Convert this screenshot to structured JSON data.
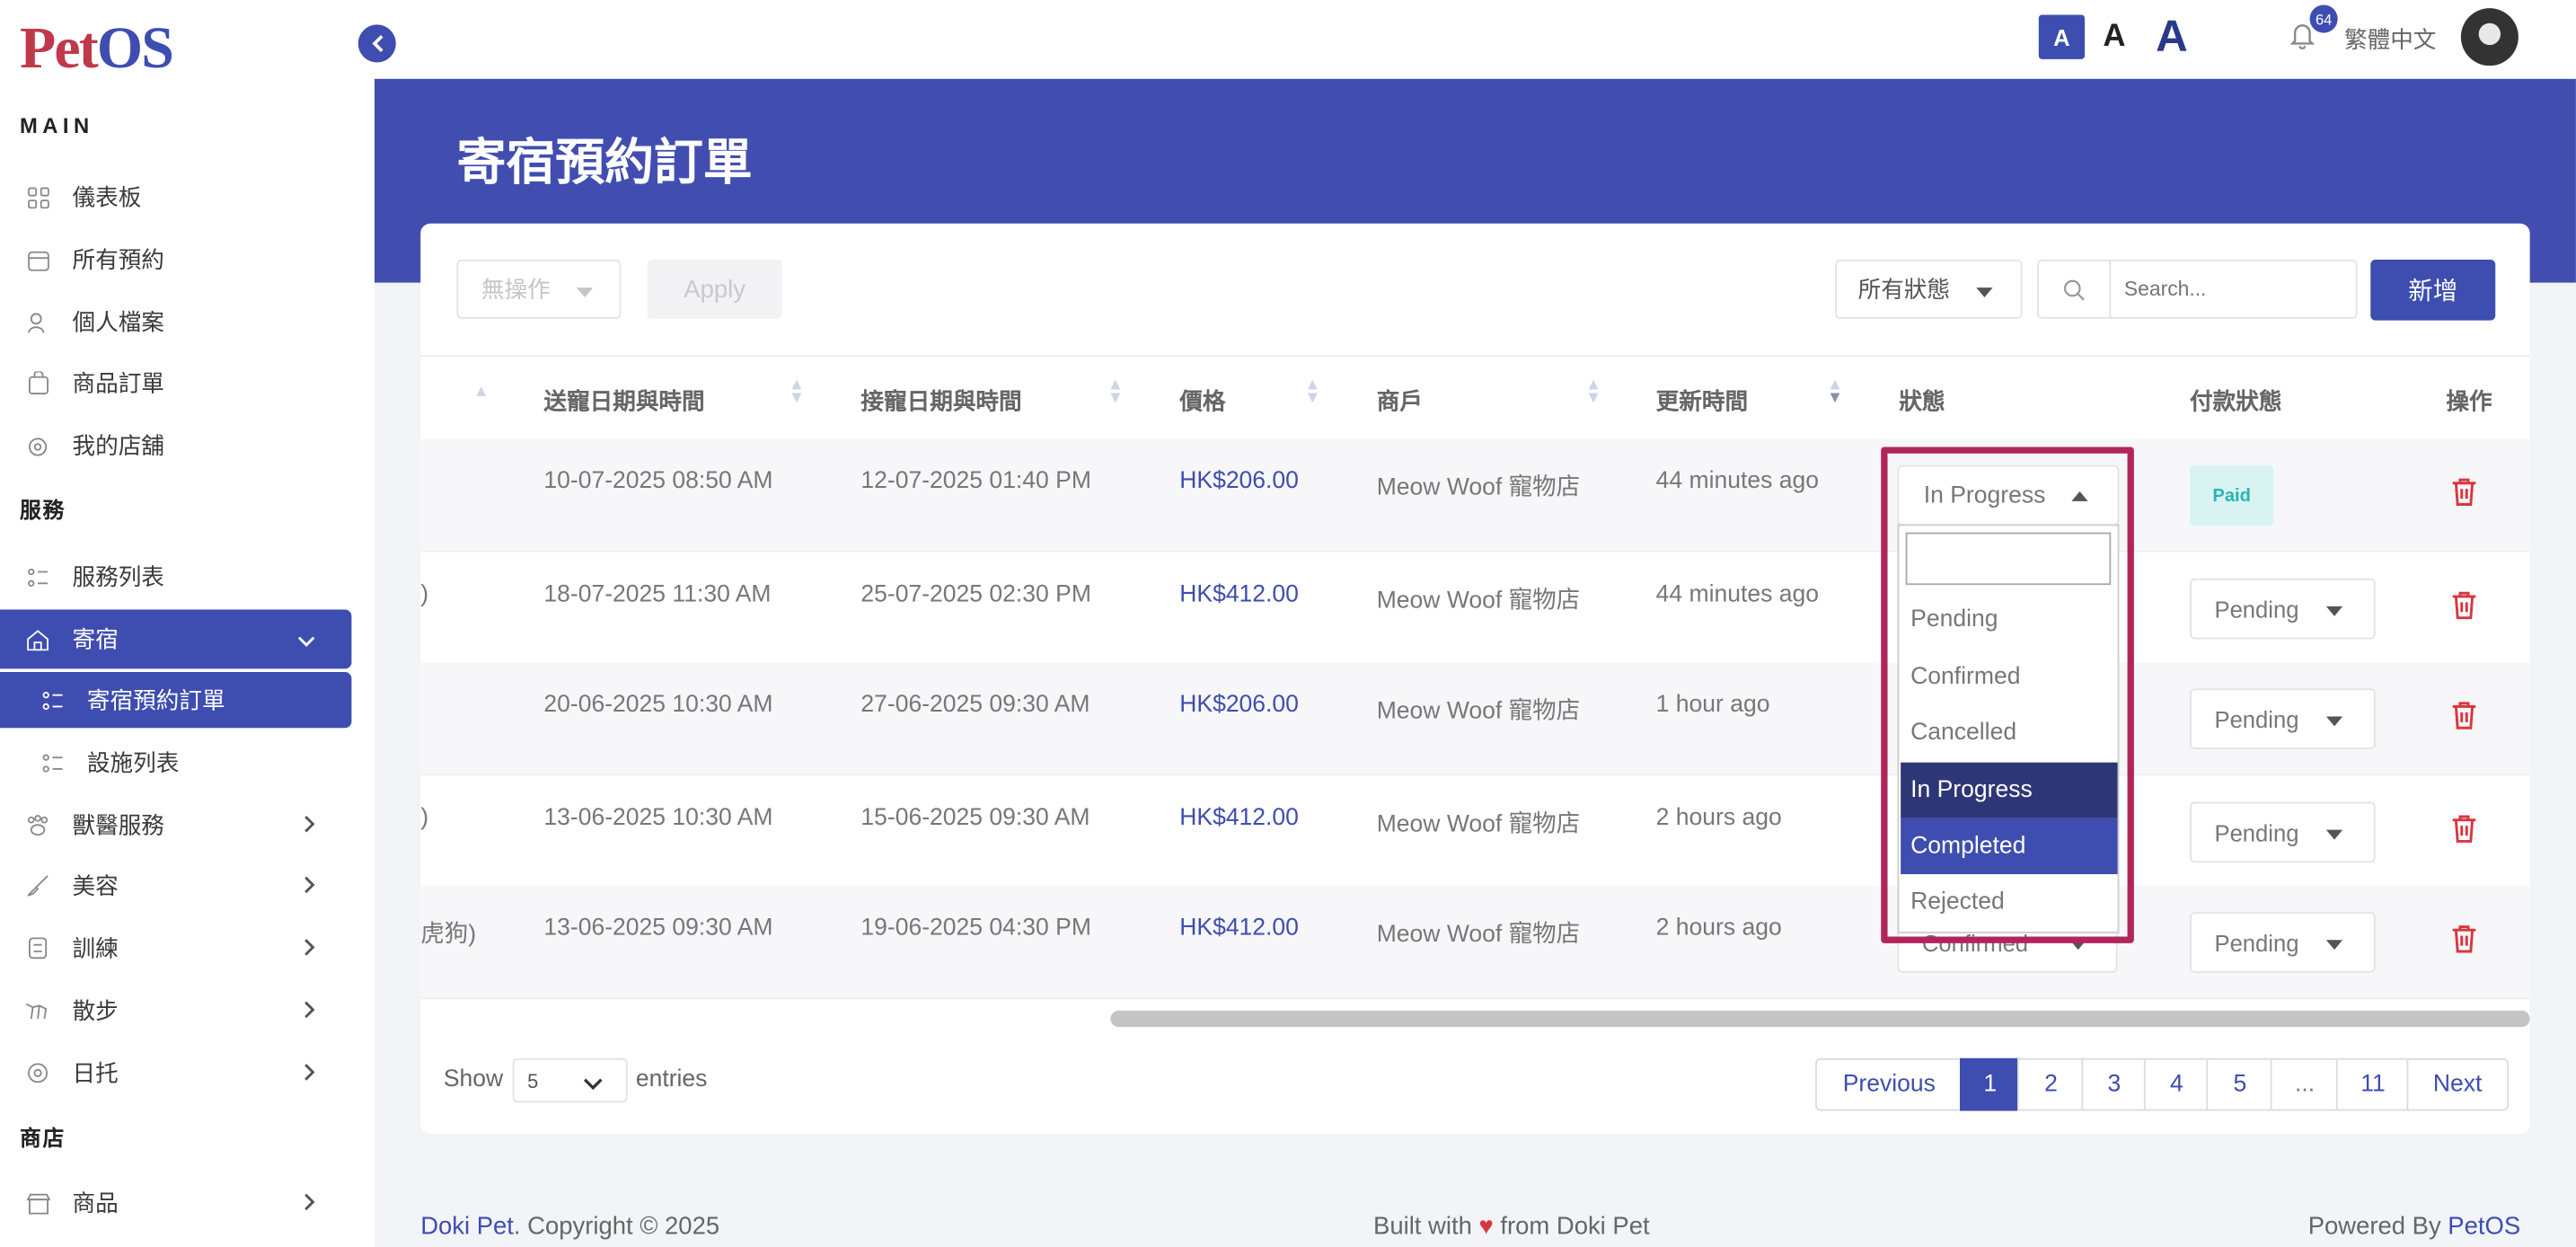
{
  "brand": {
    "logo_part1": "Pet",
    "logo_part2": "OS"
  },
  "sidebar": {
    "section_main": "MAIN",
    "section_services": "服務",
    "section_shop": "商店",
    "items": [
      {
        "label": "儀表板",
        "icon": "grid-icon"
      },
      {
        "label": "所有預約",
        "icon": "calendar-icon"
      },
      {
        "label": "個人檔案",
        "icon": "user-icon"
      },
      {
        "label": "商品訂單",
        "icon": "bag-icon"
      },
      {
        "label": "我的店舖",
        "icon": "store-icon"
      },
      {
        "label": "服務列表",
        "icon": "list-icon"
      },
      {
        "label": "寄宿",
        "icon": "home-icon"
      },
      {
        "label": "寄宿預約訂單",
        "icon": "list-icon"
      },
      {
        "label": "設施列表",
        "icon": "list-icon"
      },
      {
        "label": "獸醫服務",
        "icon": "vet-icon"
      },
      {
        "label": "美容",
        "icon": "brush-icon"
      },
      {
        "label": "訓練",
        "icon": "training-icon"
      },
      {
        "label": "散步",
        "icon": "walk-icon"
      },
      {
        "label": "日托",
        "icon": "daycare-icon"
      },
      {
        "label": "商品",
        "icon": "shop-icon"
      }
    ]
  },
  "topbar": {
    "font_small": "A",
    "font_medium": "A",
    "font_large": "A",
    "notification_count": "64",
    "language": "繁體中文"
  },
  "page": {
    "title": "寄宿預約訂單"
  },
  "toolbar": {
    "bulk_action": "無操作",
    "apply": "Apply",
    "status_filter": "所有狀態",
    "search_placeholder": "Search...",
    "add": "新增"
  },
  "table": {
    "headers": [
      "送寵日期與時間",
      "接寵日期與時間",
      "價格",
      "商戶",
      "更新時間",
      "狀態",
      "付款狀態",
      "操作"
    ],
    "rows": [
      {
        "partial": "",
        "dropoff": "10-07-2025 08:50 AM",
        "pickup": "12-07-2025 01:40 PM",
        "price": "HK$206.00",
        "merchant": "Meow Woof 寵物店",
        "updated": "44 minutes ago",
        "status": "In Progress",
        "payment": "Paid"
      },
      {
        "partial": ")",
        "dropoff": "18-07-2025 11:30 AM",
        "pickup": "25-07-2025 02:30 PM",
        "price": "HK$412.00",
        "merchant": "Meow Woof 寵物店",
        "updated": "44 minutes ago",
        "status": "",
        "payment": "Pending"
      },
      {
        "partial": "",
        "dropoff": "20-06-2025 10:30 AM",
        "pickup": "27-06-2025 09:30 AM",
        "price": "HK$206.00",
        "merchant": "Meow Woof 寵物店",
        "updated": "1 hour ago",
        "status": "",
        "payment": "Pending"
      },
      {
        "partial": ")",
        "dropoff": "13-06-2025 10:30 AM",
        "pickup": "15-06-2025 09:30 AM",
        "price": "HK$412.00",
        "merchant": "Meow Woof 寵物店",
        "updated": "2 hours ago",
        "status": "",
        "payment": "Pending"
      },
      {
        "partial": "虎狗)",
        "dropoff": "13-06-2025 09:30 AM",
        "pickup": "19-06-2025 04:30 PM",
        "price": "HK$412.00",
        "merchant": "Meow Woof 寵物店",
        "updated": "2 hours ago",
        "status": "Confirmed",
        "payment": "Pending"
      }
    ]
  },
  "status_dropdown": {
    "selected": "In Progress",
    "search_value": "",
    "options": [
      "Pending",
      "Confirmed",
      "Cancelled",
      "In Progress",
      "Completed",
      "Rejected"
    ],
    "highlighted": "In Progress",
    "hovered": "Completed"
  },
  "entries": {
    "show": "Show",
    "value": "5",
    "suffix": "entries"
  },
  "pagination": {
    "previous": "Previous",
    "pages": [
      "1",
      "2",
      "3",
      "4",
      "5",
      "...",
      "11"
    ],
    "current": "1",
    "next": "Next"
  },
  "footer": {
    "brand": "Doki Pet",
    "copyright": ". Copyright © 2025",
    "built_prefix": "Built with",
    "built_suffix": "from Doki Pet",
    "powered_prefix": "Powered By",
    "powered_brand": "PetOS"
  },
  "colors": {
    "primary": "#3e4db0",
    "header_band": "#414eb0",
    "highlight_outline": "#b0265a",
    "danger": "#d9363e",
    "paid_bg": "#d9f3f3"
  }
}
